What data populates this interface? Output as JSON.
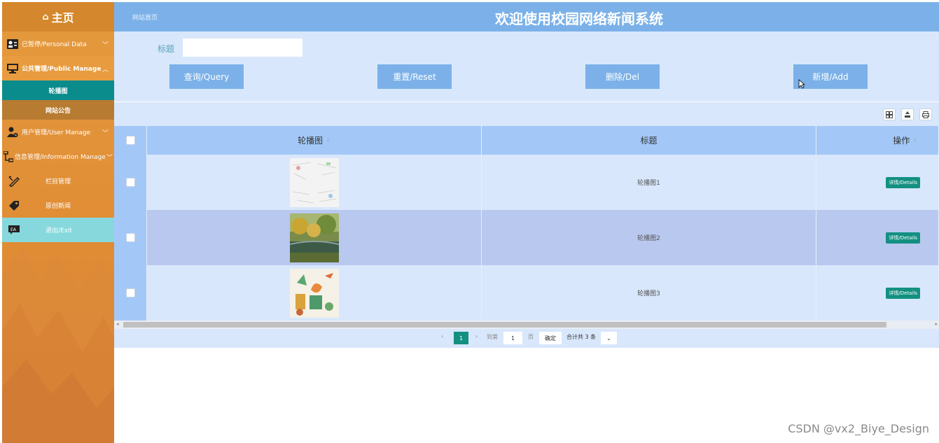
{
  "sidebar": {
    "home": "主页",
    "items": [
      {
        "label": "已暂停/Personal Data",
        "icon": "person-card-icon"
      },
      {
        "label": "公共管理/Public Manage",
        "icon": "monitor-icon"
      },
      {
        "label": "轮播图"
      },
      {
        "label": "网站公告"
      },
      {
        "label": "用户管理/User Manage",
        "icon": "user-gear-icon"
      },
      {
        "label": "信息管理/Information Manage",
        "icon": "org-chart-icon"
      },
      {
        "label": "栏目管理",
        "icon": "pencil-ruler-icon"
      },
      {
        "label": "原创新闻",
        "icon": "tag-icon"
      },
      {
        "label": "退出/Exit",
        "icon": "exit-chat-icon"
      }
    ]
  },
  "header": {
    "breadcrumb": "网站首页",
    "title": "欢迎使用校园网络新闻系统"
  },
  "search": {
    "label": "标题",
    "value": ""
  },
  "buttons": {
    "query": "查询/Query",
    "reset": "重置/Reset",
    "delete": "删除/Del",
    "add": "新增/Add"
  },
  "table": {
    "headers": [
      "轮播图",
      "标题",
      "操作"
    ],
    "rows": [
      {
        "title": "轮播图1",
        "action": "详情/Details",
        "image": "back-to-school-image"
      },
      {
        "title": "轮播图2",
        "action": "详情/Details",
        "image": "campus-landscape-image"
      },
      {
        "title": "轮播图3",
        "action": "详情/Details",
        "image": "youth-poster-image"
      }
    ]
  },
  "pager": {
    "page": "1",
    "goto_label": "到第",
    "goto_value": "1",
    "page_unit": "页",
    "confirm": "确定",
    "total": "合计共 3 条"
  },
  "watermark": "CSDN @vx2_Biye_Design",
  "colors": {
    "sidebar": "#e59a3d",
    "header": "#7bb1e8",
    "accent": "#139081",
    "panel": "#d8e7fb"
  }
}
